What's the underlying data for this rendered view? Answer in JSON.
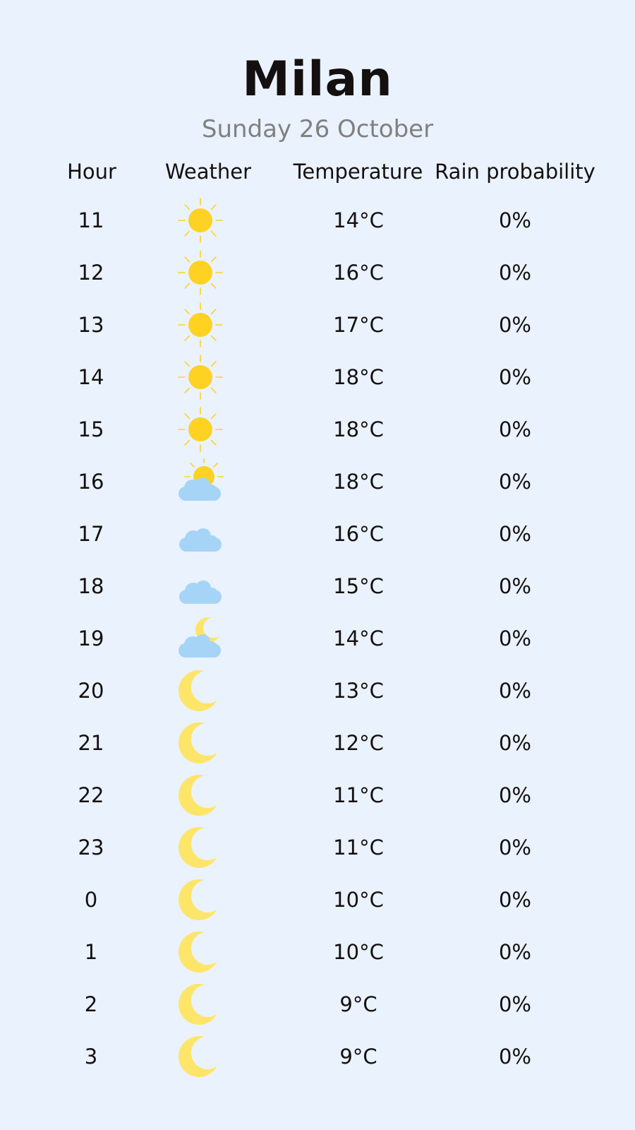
{
  "city": "Milan",
  "date": "Sunday 26 October",
  "columns": {
    "hour": "Hour",
    "weather": "Weather",
    "temperature": "Temperature",
    "rain": "Rain probability"
  },
  "colors": {
    "background": "#eaf2fe",
    "sun": "#fdd223",
    "moon": "#fde569",
    "cloud": "#a6d4f6",
    "subtitle": "#808080"
  },
  "rows": [
    {
      "hour": "11",
      "icon": "sun-icon",
      "temp": "14°C",
      "rain": "0%"
    },
    {
      "hour": "12",
      "icon": "sun-icon",
      "temp": "16°C",
      "rain": "0%"
    },
    {
      "hour": "13",
      "icon": "sun-icon",
      "temp": "17°C",
      "rain": "0%"
    },
    {
      "hour": "14",
      "icon": "sun-icon",
      "temp": "18°C",
      "rain": "0%"
    },
    {
      "hour": "15",
      "icon": "sun-icon",
      "temp": "18°C",
      "rain": "0%"
    },
    {
      "hour": "16",
      "icon": "sun-cloud-icon",
      "temp": "18°C",
      "rain": "0%"
    },
    {
      "hour": "17",
      "icon": "cloud-icon",
      "temp": "16°C",
      "rain": "0%"
    },
    {
      "hour": "18",
      "icon": "cloud-icon",
      "temp": "15°C",
      "rain": "0%"
    },
    {
      "hour": "19",
      "icon": "moon-cloud-icon",
      "temp": "14°C",
      "rain": "0%"
    },
    {
      "hour": "20",
      "icon": "moon-icon",
      "temp": "13°C",
      "rain": "0%"
    },
    {
      "hour": "21",
      "icon": "moon-icon",
      "temp": "12°C",
      "rain": "0%"
    },
    {
      "hour": "22",
      "icon": "moon-icon",
      "temp": "11°C",
      "rain": "0%"
    },
    {
      "hour": "23",
      "icon": "moon-icon",
      "temp": "11°C",
      "rain": "0%"
    },
    {
      "hour": "0",
      "icon": "moon-icon",
      "temp": "10°C",
      "rain": "0%"
    },
    {
      "hour": "1",
      "icon": "moon-icon",
      "temp": "10°C",
      "rain": "0%"
    },
    {
      "hour": "2",
      "icon": "moon-icon",
      "temp": "9°C",
      "rain": "0%"
    },
    {
      "hour": "3",
      "icon": "moon-icon",
      "temp": "9°C",
      "rain": "0%"
    }
  ]
}
